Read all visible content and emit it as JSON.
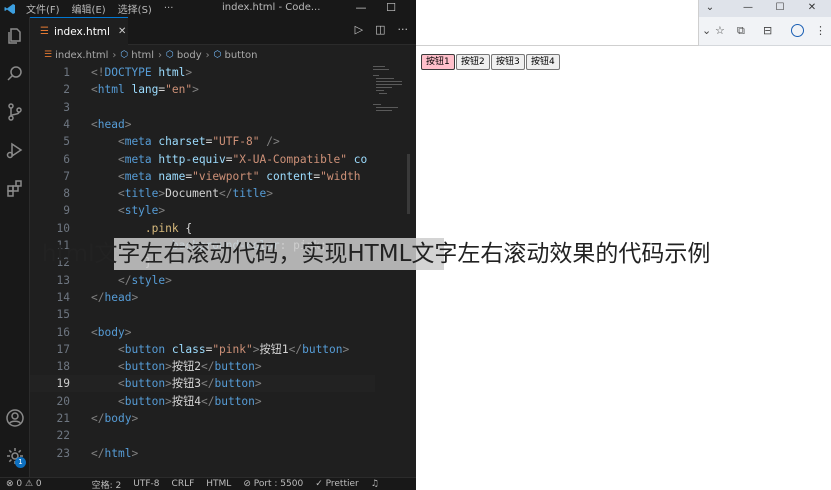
{
  "vscode": {
    "menu": [
      "文件(F)",
      "编辑(E)",
      "选择(S)",
      "···"
    ],
    "window_title": "index.html - Code...",
    "tab_label": "index.html",
    "breadcrumb": [
      "index.html",
      "html",
      "body",
      "button"
    ],
    "active_line": 19,
    "lines": [
      {
        "n": "1",
        "code": [
          [
            "tk-br",
            "<!"
          ],
          [
            "tk-tag",
            "DOCTYPE"
          ],
          [
            "tk-txt",
            " "
          ],
          [
            "tk-attr",
            "html"
          ],
          [
            "tk-br",
            ">"
          ]
        ]
      },
      {
        "n": "2",
        "code": [
          [
            "tk-br",
            "<"
          ],
          [
            "tk-tag",
            "html"
          ],
          [
            "tk-txt",
            " "
          ],
          [
            "tk-attr",
            "lang"
          ],
          [
            "tk-txt",
            "="
          ],
          [
            "tk-str",
            "\"en\""
          ],
          [
            "tk-br",
            ">"
          ]
        ]
      },
      {
        "n": "3",
        "code": []
      },
      {
        "n": "4",
        "code": [
          [
            "tk-br",
            "<"
          ],
          [
            "tk-tag",
            "head"
          ],
          [
            "tk-br",
            ">"
          ]
        ]
      },
      {
        "n": "5",
        "code": [
          [
            "tk-txt",
            "    "
          ],
          [
            "tk-br",
            "<"
          ],
          [
            "tk-tag",
            "meta"
          ],
          [
            "tk-txt",
            " "
          ],
          [
            "tk-attr",
            "charset"
          ],
          [
            "tk-txt",
            "="
          ],
          [
            "tk-str",
            "\"UTF-8\""
          ],
          [
            "tk-txt",
            " "
          ],
          [
            "tk-br",
            "/>"
          ]
        ]
      },
      {
        "n": "6",
        "code": [
          [
            "tk-txt",
            "    "
          ],
          [
            "tk-br",
            "<"
          ],
          [
            "tk-tag",
            "meta"
          ],
          [
            "tk-txt",
            " "
          ],
          [
            "tk-attr",
            "http-equiv"
          ],
          [
            "tk-txt",
            "="
          ],
          [
            "tk-str",
            "\"X-UA-Compatible\""
          ],
          [
            "tk-txt",
            " "
          ],
          [
            "tk-attr",
            "co"
          ]
        ]
      },
      {
        "n": "7",
        "code": [
          [
            "tk-txt",
            "    "
          ],
          [
            "tk-br",
            "<"
          ],
          [
            "tk-tag",
            "meta"
          ],
          [
            "tk-txt",
            " "
          ],
          [
            "tk-attr",
            "name"
          ],
          [
            "tk-txt",
            "="
          ],
          [
            "tk-str",
            "\"viewport\""
          ],
          [
            "tk-txt",
            " "
          ],
          [
            "tk-attr",
            "content"
          ],
          [
            "tk-txt",
            "="
          ],
          [
            "tk-str",
            "\"width"
          ]
        ]
      },
      {
        "n": "8",
        "code": [
          [
            "tk-txt",
            "    "
          ],
          [
            "tk-br",
            "<"
          ],
          [
            "tk-tag",
            "title"
          ],
          [
            "tk-br",
            ">"
          ],
          [
            "tk-txt",
            "Document"
          ],
          [
            "tk-br",
            "</"
          ],
          [
            "tk-tag",
            "title"
          ],
          [
            "tk-br",
            ">"
          ]
        ]
      },
      {
        "n": "9",
        "code": [
          [
            "tk-txt",
            "    "
          ],
          [
            "tk-br",
            "<"
          ],
          [
            "tk-tag",
            "style"
          ],
          [
            "tk-br",
            ">"
          ]
        ]
      },
      {
        "n": "10",
        "code": [
          [
            "tk-txt",
            "        "
          ],
          [
            "tk-sel",
            ".pink"
          ],
          [
            "tk-txt",
            " {"
          ]
        ]
      },
      {
        "n": "11",
        "code": [
          [
            "tk-txt",
            "            "
          ],
          [
            "tk-attr",
            "background-color"
          ],
          [
            "tk-txt",
            ": "
          ],
          [
            "tk-txt",
            "pink"
          ],
          [
            "tk-txt",
            ";"
          ]
        ]
      },
      {
        "n": "12",
        "code": [
          [
            "tk-txt",
            "        }"
          ]
        ]
      },
      {
        "n": "13",
        "code": [
          [
            "tk-txt",
            "    "
          ],
          [
            "tk-br",
            "</"
          ],
          [
            "tk-tag",
            "style"
          ],
          [
            "tk-br",
            ">"
          ]
        ]
      },
      {
        "n": "14",
        "code": [
          [
            "tk-br",
            "</"
          ],
          [
            "tk-tag",
            "head"
          ],
          [
            "tk-br",
            ">"
          ]
        ]
      },
      {
        "n": "15",
        "code": []
      },
      {
        "n": "16",
        "code": [
          [
            "tk-br",
            "<"
          ],
          [
            "tk-tag",
            "body"
          ],
          [
            "tk-br",
            ">"
          ]
        ]
      },
      {
        "n": "17",
        "code": [
          [
            "tk-txt",
            "    "
          ],
          [
            "tk-br",
            "<"
          ],
          [
            "tk-tag",
            "button"
          ],
          [
            "tk-txt",
            " "
          ],
          [
            "tk-attr",
            "class"
          ],
          [
            "tk-txt",
            "="
          ],
          [
            "tk-str",
            "\"pink\""
          ],
          [
            "tk-br",
            ">"
          ],
          [
            "tk-txt",
            "按钮1"
          ],
          [
            "tk-br",
            "</"
          ],
          [
            "tk-tag",
            "button"
          ],
          [
            "tk-br",
            ">"
          ]
        ]
      },
      {
        "n": "18",
        "code": [
          [
            "tk-txt",
            "    "
          ],
          [
            "tk-br",
            "<"
          ],
          [
            "tk-tag",
            "button"
          ],
          [
            "tk-br",
            ">"
          ],
          [
            "tk-txt",
            "按钮2"
          ],
          [
            "tk-br",
            "</"
          ],
          [
            "tk-tag",
            "button"
          ],
          [
            "tk-br",
            ">"
          ]
        ]
      },
      {
        "n": "19",
        "code": [
          [
            "tk-txt",
            "    "
          ],
          [
            "tk-br",
            "<"
          ],
          [
            "tk-tag",
            "button"
          ],
          [
            "tk-br",
            ">"
          ],
          [
            "tk-txt",
            "按钮3"
          ],
          [
            "tk-br",
            "</"
          ],
          [
            "tk-tag",
            "button"
          ],
          [
            "tk-br",
            ">"
          ]
        ]
      },
      {
        "n": "20",
        "code": [
          [
            "tk-txt",
            "    "
          ],
          [
            "tk-br",
            "<"
          ],
          [
            "tk-tag",
            "button"
          ],
          [
            "tk-br",
            ">"
          ],
          [
            "tk-txt",
            "按钮4"
          ],
          [
            "tk-br",
            "</"
          ],
          [
            "tk-tag",
            "button"
          ],
          [
            "tk-br",
            ">"
          ]
        ]
      },
      {
        "n": "21",
        "code": [
          [
            "tk-br",
            "</"
          ],
          [
            "tk-tag",
            "body"
          ],
          [
            "tk-br",
            ">"
          ]
        ]
      },
      {
        "n": "22",
        "code": []
      },
      {
        "n": "23",
        "code": [
          [
            "tk-br",
            "</"
          ],
          [
            "tk-tag",
            "html"
          ],
          [
            "tk-br",
            ">"
          ]
        ]
      }
    ],
    "status": {
      "problems": "⊗ 0 ⚠ 0",
      "spaces": "空格: 2",
      "encoding": "UTF-8",
      "eol": "CRLF",
      "language": "HTML",
      "port": "⊘ Port : 5500",
      "prettier": "✓ Prettier"
    },
    "account_badge": "1"
  },
  "browser": {
    "buttons": [
      {
        "label": "按钮1",
        "pink": true
      },
      {
        "label": "按钮2",
        "pink": false
      },
      {
        "label": "按钮3",
        "pink": false
      },
      {
        "label": "按钮4",
        "pink": false
      }
    ],
    "pink_color": "#ffc0cb"
  },
  "overlay": {
    "caption": "html文字左右滚动代码，实现HTML文字左右滚动效果的代码示例"
  }
}
